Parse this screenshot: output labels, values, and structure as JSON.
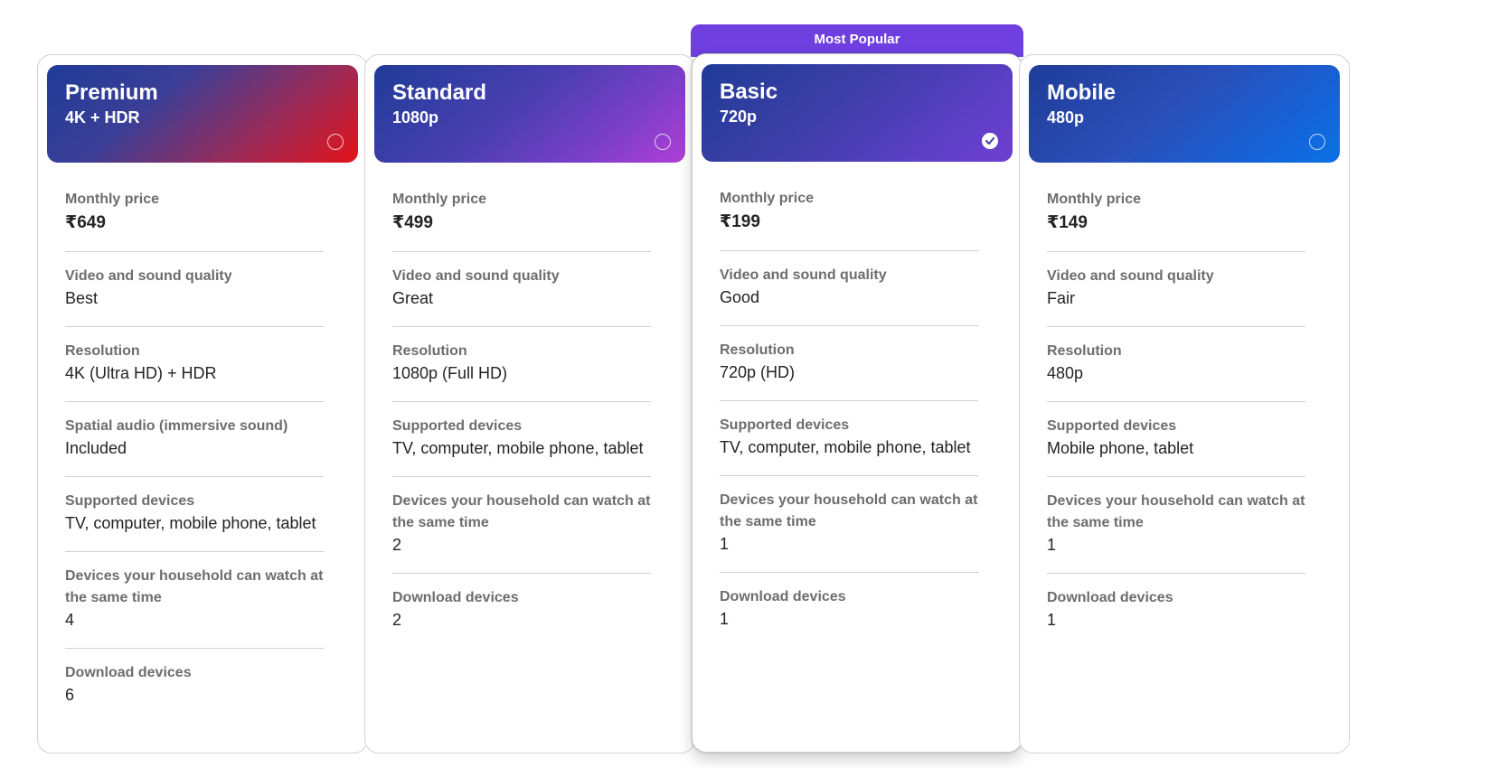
{
  "badge": "Most Popular",
  "plans": [
    {
      "name": "Premium",
      "resolution_short": "4K + HDR",
      "selected": false,
      "features": [
        {
          "label": "Monthly price",
          "value": "₹649"
        },
        {
          "label": "Video and sound quality",
          "value": "Best"
        },
        {
          "label": "Resolution",
          "value": "4K (Ultra HD) + HDR"
        },
        {
          "label": "Spatial audio (immersive sound)",
          "value": "Included"
        },
        {
          "label": "Supported devices",
          "value": "TV, computer, mobile phone, tablet"
        },
        {
          "label": "Devices your household can watch at the same time",
          "value": "4"
        },
        {
          "label": "Download devices",
          "value": "6"
        }
      ]
    },
    {
      "name": "Standard",
      "resolution_short": "1080p",
      "selected": false,
      "features": [
        {
          "label": "Monthly price",
          "value": "₹499"
        },
        {
          "label": "Video and sound quality",
          "value": "Great"
        },
        {
          "label": "Resolution",
          "value": "1080p (Full HD)"
        },
        {
          "label": "Supported devices",
          "value": "TV, computer, mobile phone, tablet"
        },
        {
          "label": "Devices your household can watch at the same time",
          "value": "2"
        },
        {
          "label": "Download devices",
          "value": "2"
        }
      ]
    },
    {
      "name": "Basic",
      "resolution_short": "720p",
      "selected": true,
      "features": [
        {
          "label": "Monthly price",
          "value": "₹199"
        },
        {
          "label": "Video and sound quality",
          "value": "Good"
        },
        {
          "label": "Resolution",
          "value": "720p (HD)"
        },
        {
          "label": "Supported devices",
          "value": "TV, computer, mobile phone, tablet"
        },
        {
          "label": "Devices your household can watch at the same time",
          "value": "1"
        },
        {
          "label": "Download devices",
          "value": "1"
        }
      ]
    },
    {
      "name": "Mobile",
      "resolution_short": "480p",
      "selected": false,
      "features": [
        {
          "label": "Monthly price",
          "value": "₹149"
        },
        {
          "label": "Video and sound quality",
          "value": "Fair"
        },
        {
          "label": "Resolution",
          "value": "480p"
        },
        {
          "label": "Supported devices",
          "value": "Mobile phone, tablet"
        },
        {
          "label": "Devices your household can watch at the same time",
          "value": "1"
        },
        {
          "label": "Download devices",
          "value": "1"
        }
      ]
    }
  ],
  "colors": {
    "badge": "#6f3fe0",
    "label_text": "#6d6d6d",
    "value_text": "#232323"
  }
}
